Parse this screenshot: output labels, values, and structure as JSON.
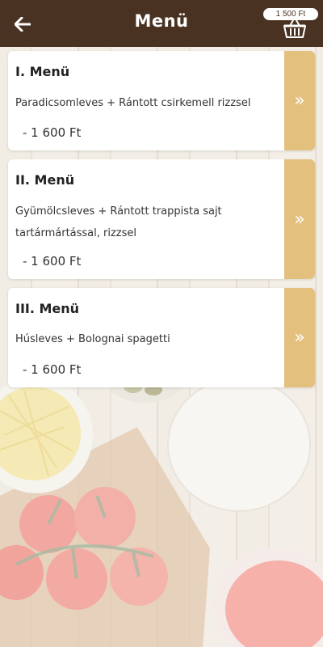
{
  "header": {
    "title": "Menü",
    "back_icon": "arrow-left-icon",
    "cart_total": "1 500 Ft",
    "basket_icon": "basket-icon"
  },
  "colors": {
    "header_bg": "#4a3223",
    "accent": "#e4c07f",
    "card_bg": "#ffffff"
  },
  "menus": [
    {
      "title": "I. Menü",
      "description": "Paradicsomleves + Rántott csirkemell rizzsel",
      "price": "- 1 600 Ft",
      "arrow": "»"
    },
    {
      "title": "II. Menü",
      "description": "Gyümölcsleves + Rántott trappista sajt tartármártással, rizzsel",
      "price": "- 1 600 Ft",
      "arrow": "»"
    },
    {
      "title": "III. Menü",
      "description": "Húsleves + Bolognai spagetti",
      "price": "- 1 600 Ft",
      "arrow": "»"
    }
  ]
}
